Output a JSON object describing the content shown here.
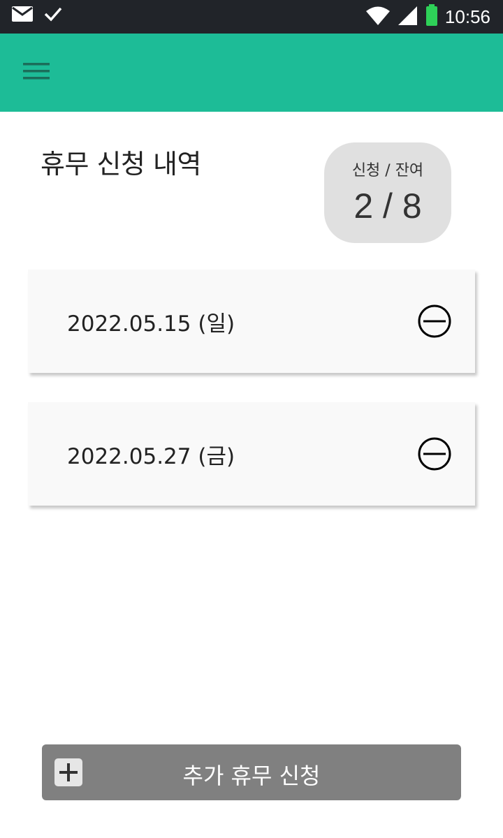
{
  "status_bar": {
    "time": "10:56",
    "icons": [
      "mail-icon",
      "check-icon",
      "wifi-icon",
      "signal-icon",
      "battery-icon"
    ],
    "background": "#212429"
  },
  "app_bar": {
    "color": "#1dbc97",
    "menu_icon": "hamburger-menu-icon"
  },
  "page": {
    "title": "휴무 신청 내역"
  },
  "summary": {
    "label": "신청 / 잔여",
    "value": "2 / 8"
  },
  "leave_list": [
    {
      "date": "2022.05.15 (일)",
      "action_icon": "remove-circle-icon"
    },
    {
      "date": "2022.05.27 (금)",
      "action_icon": "remove-circle-icon"
    }
  ],
  "add_button": {
    "label": "추가 휴무 신청",
    "icon": "plus-icon",
    "color": "#808080"
  }
}
